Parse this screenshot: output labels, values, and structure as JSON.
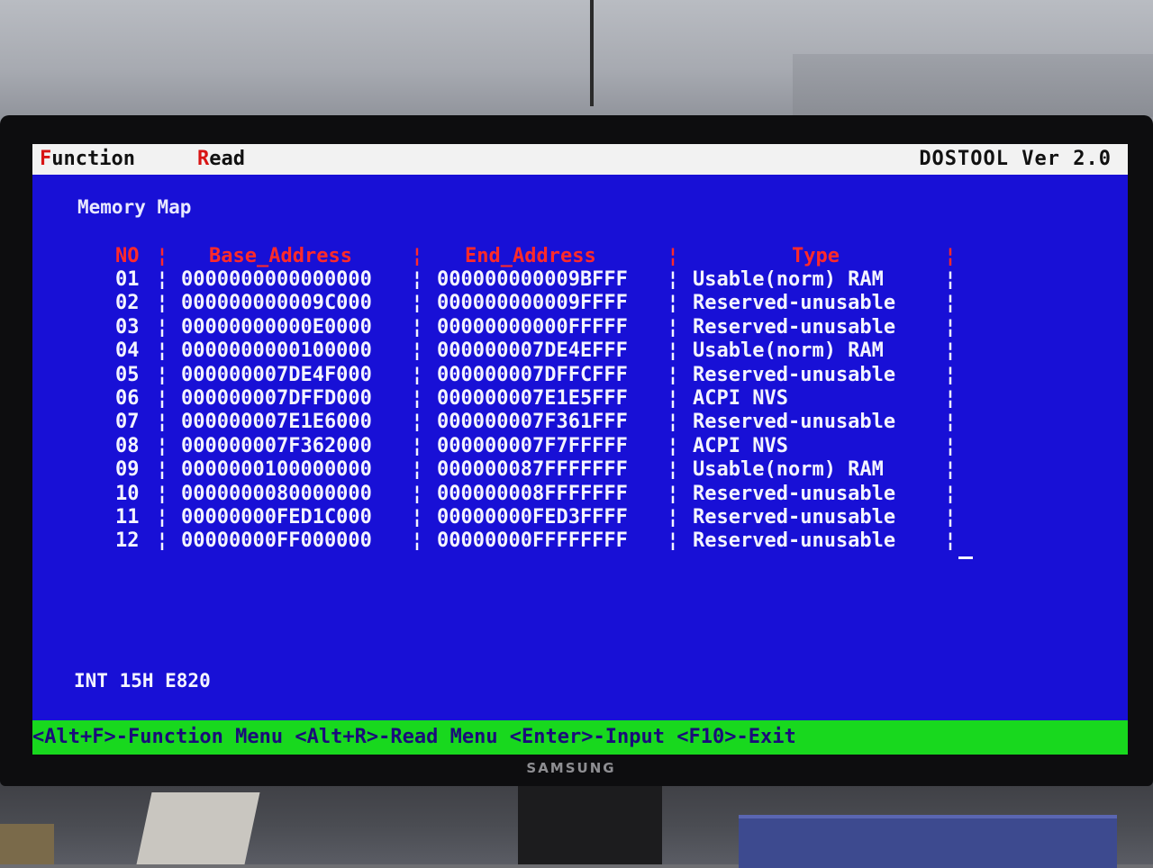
{
  "menu": {
    "function_hotkey": "F",
    "function_rest": "unction",
    "read_hotkey": "R",
    "read_rest": "ead",
    "app_version": "DOSTOOL Ver 2.0"
  },
  "screen_title": "Memory Map",
  "separator": "¦",
  "table": {
    "headers": {
      "no": "NO",
      "base": "Base_Address",
      "end": "End_Address",
      "type": "Type"
    },
    "rows": [
      {
        "no": "01",
        "base": "0000000000000000",
        "end": "000000000009BFFF",
        "type": "Usable(norm) RAM"
      },
      {
        "no": "02",
        "base": "000000000009C000",
        "end": "000000000009FFFF",
        "type": "Reserved-unusable"
      },
      {
        "no": "03",
        "base": "00000000000E0000",
        "end": "00000000000FFFFF",
        "type": "Reserved-unusable"
      },
      {
        "no": "04",
        "base": "0000000000100000",
        "end": "000000007DE4EFFF",
        "type": "Usable(norm) RAM"
      },
      {
        "no": "05",
        "base": "000000007DE4F000",
        "end": "000000007DFFCFFF",
        "type": "Reserved-unusable"
      },
      {
        "no": "06",
        "base": "000000007DFFD000",
        "end": "000000007E1E5FFF",
        "type": "ACPI NVS"
      },
      {
        "no": "07",
        "base": "000000007E1E6000",
        "end": "000000007F361FFF",
        "type": "Reserved-unusable"
      },
      {
        "no": "08",
        "base": "000000007F362000",
        "end": "000000007F7FFFFF",
        "type": "ACPI NVS"
      },
      {
        "no": "09",
        "base": "0000000100000000",
        "end": "000000087FFFFFFF",
        "type": "Usable(norm) RAM"
      },
      {
        "no": "10",
        "base": "0000000080000000",
        "end": "000000008FFFFFFF",
        "type": "Reserved-unusable"
      },
      {
        "no": "11",
        "base": "00000000FED1C000",
        "end": "00000000FED3FFFF",
        "type": "Reserved-unusable"
      },
      {
        "no": "12",
        "base": "00000000FF000000",
        "end": "00000000FFFFFFFF",
        "type": "Reserved-unusable"
      }
    ]
  },
  "interrupt_label": "INT 15H E820",
  "status_bar": "<Alt+F>-Function Menu <Alt+R>-Read Menu <Enter>-Input <F10>-Exit",
  "monitor_brand": "SAMSUNG",
  "colors": {
    "screen_background": "#1810d6",
    "menubar_background": "#f2f2f2",
    "header_text": "#ff2a2a",
    "status_bar_background": "#18d81e"
  }
}
